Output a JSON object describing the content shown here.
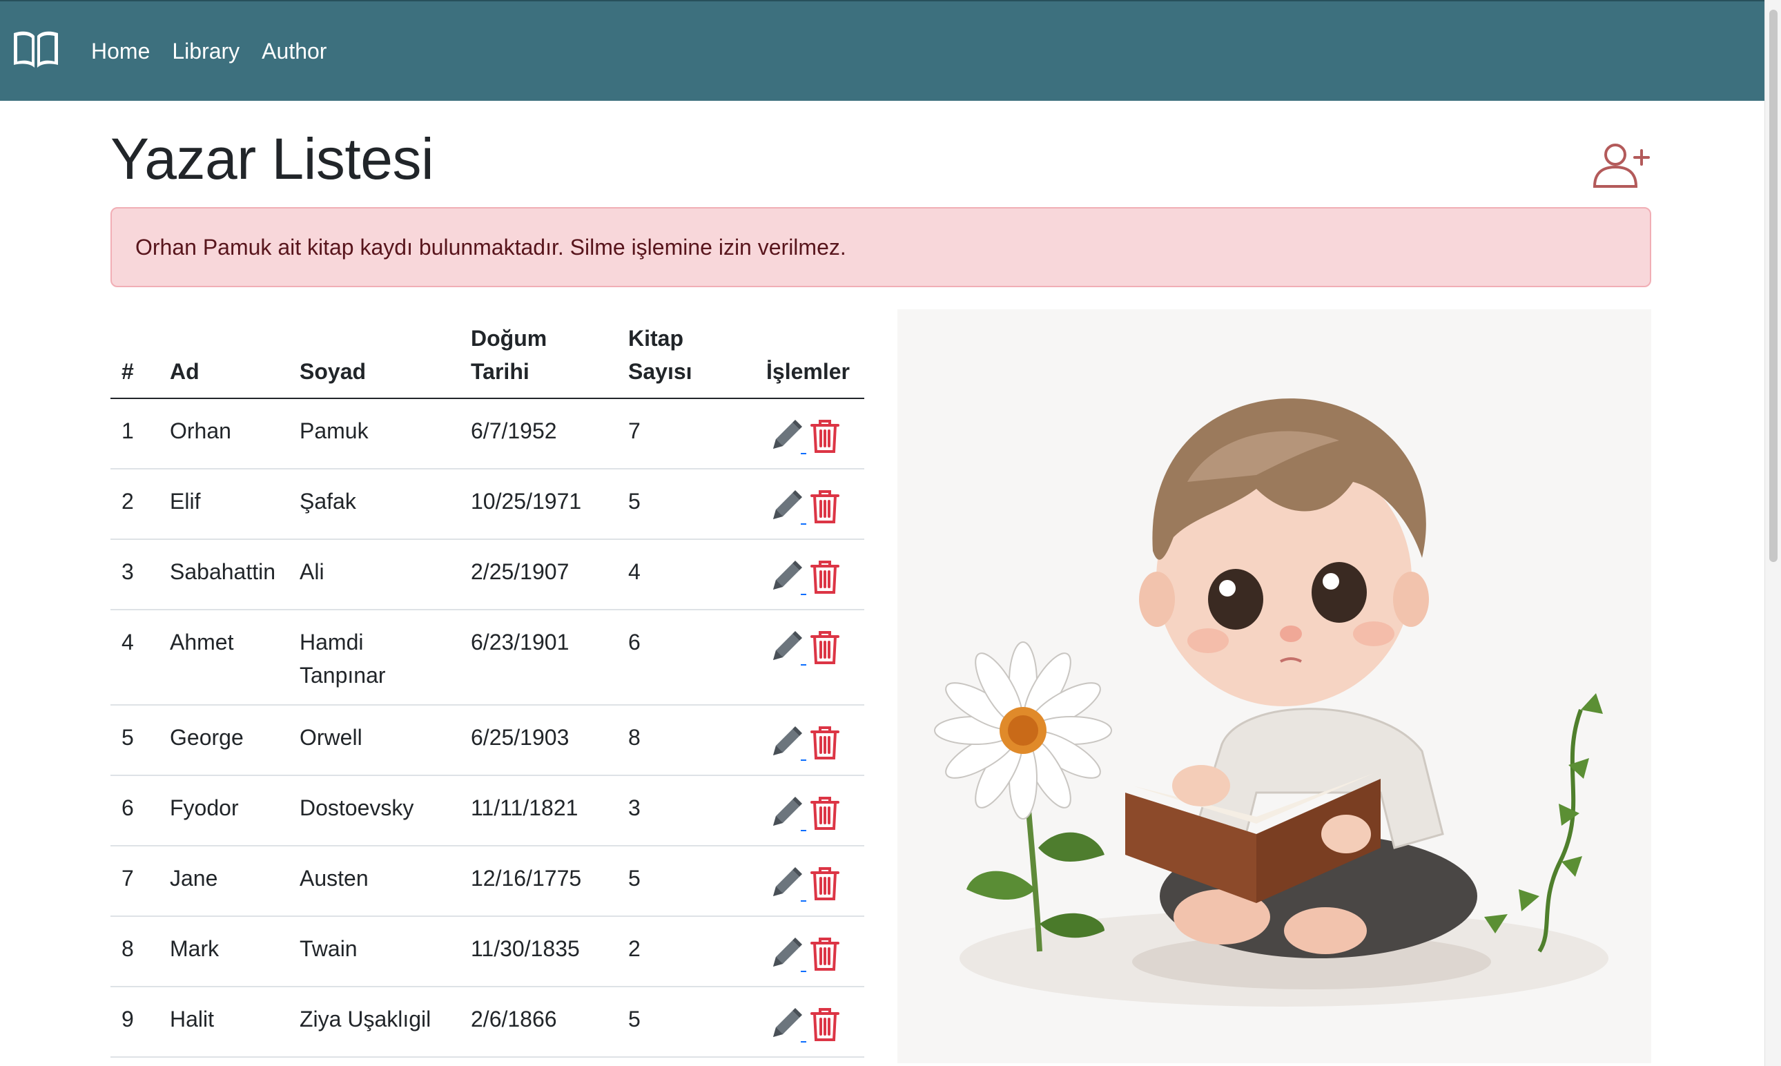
{
  "nav": {
    "brand_icon": "open-book-icon",
    "links": [
      "Home",
      "Library",
      "Author"
    ]
  },
  "page": {
    "title": "Yazar Listesi",
    "add_icon": "add-user-icon"
  },
  "alert": {
    "message": "Orhan Pamuk ait kitap kaydı bulunmaktadır. Silme işlemine izin verilmez."
  },
  "table": {
    "headers": {
      "num": "#",
      "ad": "Ad",
      "soyad": "Soyad",
      "dogum_line1": "Doğum",
      "dogum_line2": "Tarihi",
      "kitap_line1": "Kitap",
      "kitap_line2": "Sayısı",
      "islemler": "İşlemler"
    },
    "rows": [
      {
        "num": "1",
        "ad": "Orhan",
        "soyad": "Pamuk",
        "dogum": "6/7/1952",
        "kitap": "7"
      },
      {
        "num": "2",
        "ad": "Elif",
        "soyad": "Şafak",
        "dogum": "10/25/1971",
        "kitap": "5"
      },
      {
        "num": "3",
        "ad": "Sabahattin",
        "soyad": "Ali",
        "dogum": "2/25/1907",
        "kitap": "4"
      },
      {
        "num": "4",
        "ad": "Ahmet",
        "soyad": "Hamdi Tanpınar",
        "dogum": "6/23/1901",
        "kitap": "6"
      },
      {
        "num": "5",
        "ad": "George",
        "soyad": "Orwell",
        "dogum": "6/25/1903",
        "kitap": "8"
      },
      {
        "num": "6",
        "ad": "Fyodor",
        "soyad": "Dostoevsky",
        "dogum": "11/11/1821",
        "kitap": "3"
      },
      {
        "num": "7",
        "ad": "Jane",
        "soyad": "Austen",
        "dogum": "12/16/1775",
        "kitap": "5"
      },
      {
        "num": "8",
        "ad": "Mark",
        "soyad": "Twain",
        "dogum": "11/30/1835",
        "kitap": "2"
      },
      {
        "num": "9",
        "ad": "Halit",
        "soyad": "Ziya Uşaklıgil",
        "dogum": "2/6/1866",
        "kitap": "5"
      }
    ],
    "row_icons": {
      "edit": "pencil-icon",
      "delete": "trash-icon"
    }
  },
  "colors": {
    "navbar": "#3d707e",
    "alert_bg": "#f8d7da",
    "alert_text": "#58151c",
    "danger": "#dc3545",
    "edit_icon": "#6c757d",
    "add_user_icon": "#b35a5a"
  }
}
